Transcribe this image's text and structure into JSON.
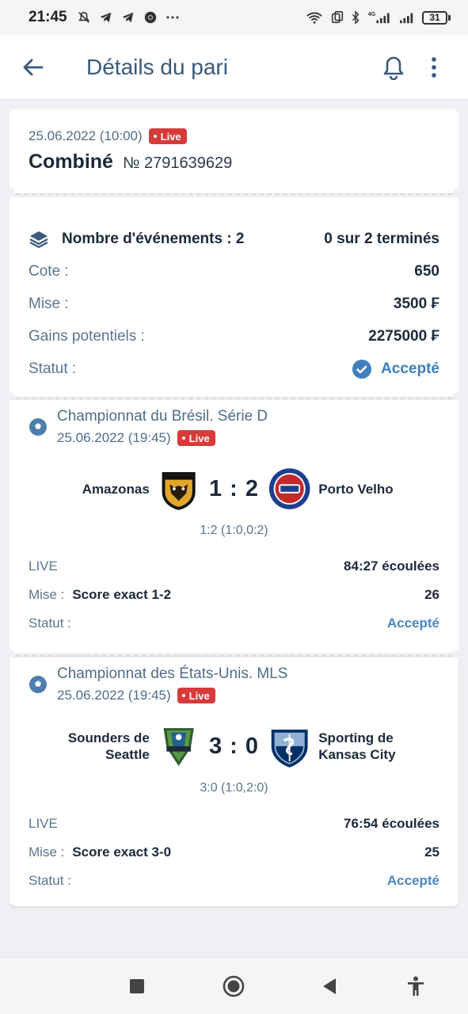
{
  "status_bar": {
    "time": "21:45",
    "icons": [
      "mute-icon",
      "telegram-icon",
      "telegram-icon",
      "chrome-icon",
      "more-dots"
    ],
    "right_icons": [
      "wifi-icon",
      "data-icon",
      "bluetooth-icon",
      "signal-4g-icon",
      "signal-icon"
    ],
    "network_label": "4G",
    "battery": "31"
  },
  "appbar": {
    "title": "Détails du pari"
  },
  "bet": {
    "date": "25.06.2022 (10:00)",
    "live_badge": "Live",
    "type": "Combiné",
    "number": "№ 2791639629"
  },
  "summary": {
    "events_label": "Nombre d'événements : 2",
    "events_status": "0 sur 2 terminés",
    "rows": [
      {
        "label": "Cote :",
        "value": "650"
      },
      {
        "label": "Mise :",
        "value": "3500 ₣"
      },
      {
        "label": "Gains potentiels :",
        "value": "2275000 ₣"
      }
    ],
    "status_label": "Statut :",
    "status_value": "Accepté"
  },
  "events": [
    {
      "championship": "Championnat du Brésil. Série D",
      "date": "25.06.2022 (19:45)",
      "live_badge": "Live",
      "home": "Amazonas",
      "away": "Porto Velho",
      "score": "1 : 2",
      "detail": "1:2 (1:0,0:2)",
      "live_label": "LIVE",
      "elapsed": "84:27 écoulées",
      "mise_label": "Mise :",
      "pick": "Score exact 1-2",
      "odds": "26",
      "status_label": "Statut :",
      "status_value": "Accepté"
    },
    {
      "championship": "Championnat des États-Unis. MLS",
      "date": "25.06.2022 (19:45)",
      "live_badge": "Live",
      "home_line1": "Sounders de",
      "home_line2": "Seattle",
      "away_line1": "Sporting de",
      "away_line2": "Kansas City",
      "score": "3 : 0",
      "detail": "3:0 (1:0,2:0)",
      "live_label": "LIVE",
      "elapsed": "76:54 écoulées",
      "mise_label": "Mise :",
      "pick": "Score exact 3-0",
      "odds": "25",
      "status_label": "Statut :",
      "status_value": "Accepté"
    }
  ],
  "colors": {
    "accent": "#3f7fbf",
    "live_badge": "#d83a3a",
    "title": "#3a5a7a",
    "text_dark": "#1b2a3a"
  }
}
